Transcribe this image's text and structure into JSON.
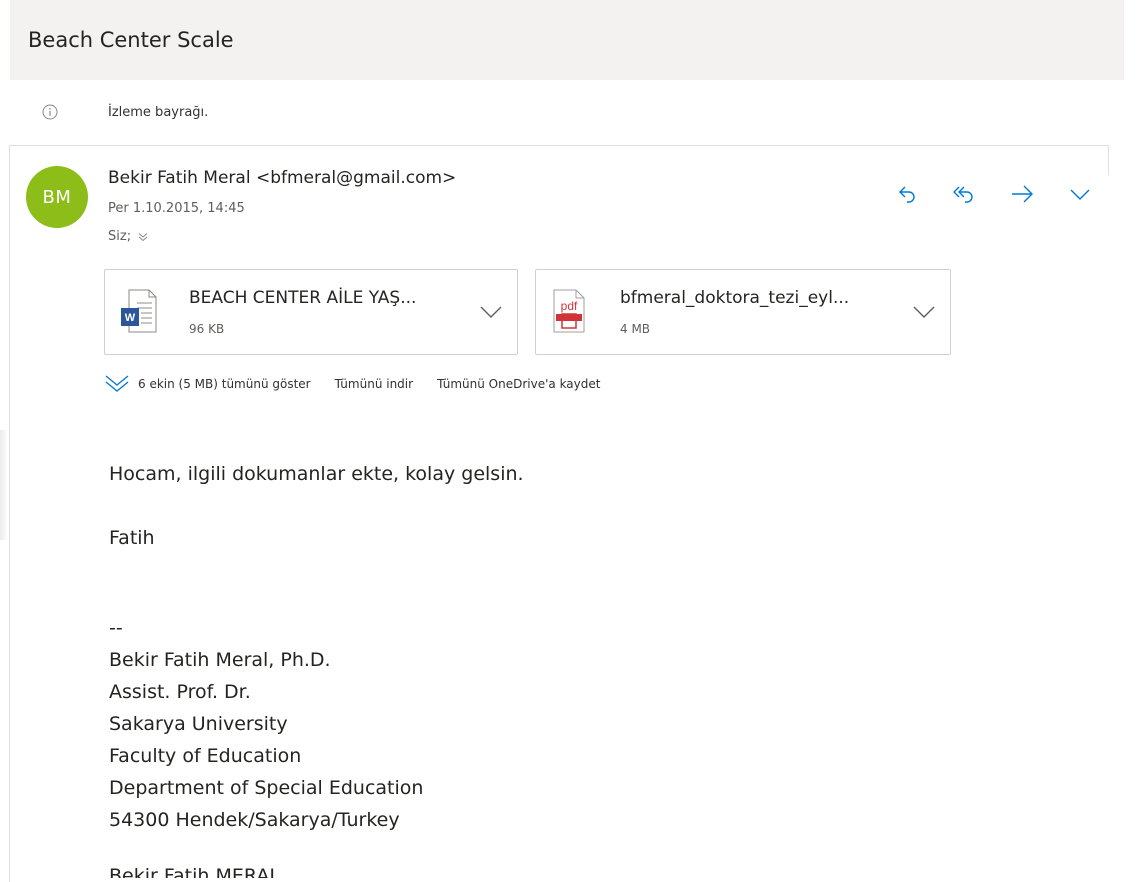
{
  "email": {
    "subject": "Beach Center Scale",
    "flag_text": "İzleme bayrağı.",
    "sender": {
      "initials": "BM",
      "display": "Bekir Fatih Meral <bfmeral@gmail.com>",
      "date": "Per 1.10.2015, 14:45",
      "to": "Siz;"
    },
    "colors": {
      "avatar": "#8cbd18",
      "accent": "#0078d4",
      "subject_bar": "#f3f2f1"
    },
    "actions": [
      {
        "icon": "reply-icon"
      },
      {
        "icon": "reply-all-icon"
      },
      {
        "icon": "forward-icon"
      },
      {
        "icon": "chevron-down-icon"
      }
    ],
    "attachments": [
      {
        "name": "BEACH CENTER AİLE YAŞ...",
        "size": "96 KB",
        "icon": "word-file-icon"
      },
      {
        "name": "bfmeral_doktora_tezi_eyl...",
        "size": "4 MB",
        "icon": "pdf-file-icon"
      }
    ],
    "attachment_bar": {
      "show_all": "6 ekin (5 MB) tümünü göster",
      "download_all": "Tümünü indir",
      "save_onedrive": "Tümünü OneDrive'a kaydet"
    },
    "body": {
      "greeting": "Hocam, ilgili dokumanlar ekte, kolay gelsin.",
      "signoff": "Fatih"
    },
    "signature": {
      "separator": "--",
      "lines": [
        "Bekir Fatih Meral, Ph.D.",
        "Assist. Prof. Dr.",
        "Sakarya University",
        "Faculty of Education",
        "Department of Special Education",
        "54300 Hendek/Sakarya/Turkey"
      ],
      "name_caps": "Bekir Fatih MERAL"
    }
  }
}
